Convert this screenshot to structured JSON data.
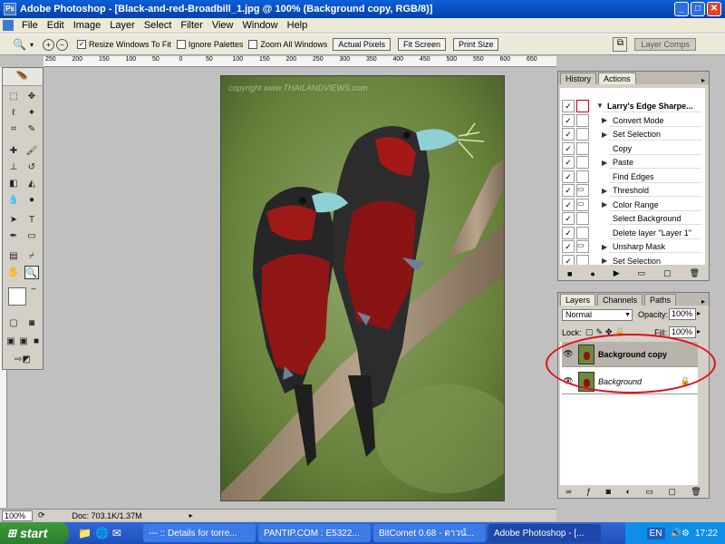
{
  "window": {
    "title": "Adobe Photoshop - [Black-and-red-Broadbill_1.jpg @ 100% (Background copy, RGB/8)]",
    "minimize": "_",
    "restore": "□",
    "close": "✕"
  },
  "menu": [
    "File",
    "Edit",
    "Image",
    "Layer",
    "Select",
    "Filter",
    "View",
    "Window",
    "Help"
  ],
  "options": {
    "resize_windows": "Resize Windows To Fit",
    "ignore_palettes": "Ignore Palettes",
    "zoom_all": "Zoom All Windows",
    "actual_pixels": "Actual Pixels",
    "fit_screen": "Fit Screen",
    "print_size": "Print Size",
    "layer_comps": "Layer Comps"
  },
  "ruler_labels": [
    "250",
    "200",
    "150",
    "100",
    "50",
    "0",
    "50",
    "100",
    "150",
    "200",
    "250",
    "300",
    "350",
    "400",
    "450",
    "500",
    "550",
    "600",
    "650"
  ],
  "canvas": {
    "watermark": "copyright www.THAILANDVIEWS.com"
  },
  "actions_panel": {
    "tabs": [
      "History",
      "Actions"
    ],
    "set_name": "Larry's Edge Sharpe...",
    "items": [
      "Convert Mode",
      "Set Selection",
      "Copy",
      "Paste",
      "Find Edges",
      "Threshold",
      "Color Range",
      "Select Background",
      "Delete layer \"Layer 1\"",
      "Unsharp Mask",
      "Set Selection"
    ]
  },
  "layers_panel": {
    "tabs": [
      "Layers",
      "Channels",
      "Paths"
    ],
    "blend_mode": "Normal",
    "opacity_label": "Opacity:",
    "opacity_value": "100%",
    "lock_label": "Lock:",
    "fill_label": "Fill:",
    "fill_value": "100%",
    "layers": [
      {
        "name": "Background copy",
        "selected": true
      },
      {
        "name": "Background",
        "selected": false
      }
    ]
  },
  "status": {
    "zoom": "100%",
    "doc": "Doc: 703.1K/1.37M"
  },
  "taskbar": {
    "start": "start",
    "tasks": [
      "--- :: Details for torre...",
      "PANTIP.COM : E5322...",
      "BitComet 0.68 - ดาวน์...",
      "Adobe Photoshop - [..."
    ],
    "lang": "EN",
    "time": "17:22"
  },
  "colors": {
    "title_bar": "#0a5fd8",
    "annotation_circle": "#e0101a",
    "taskbar": "#1e4fb8"
  }
}
